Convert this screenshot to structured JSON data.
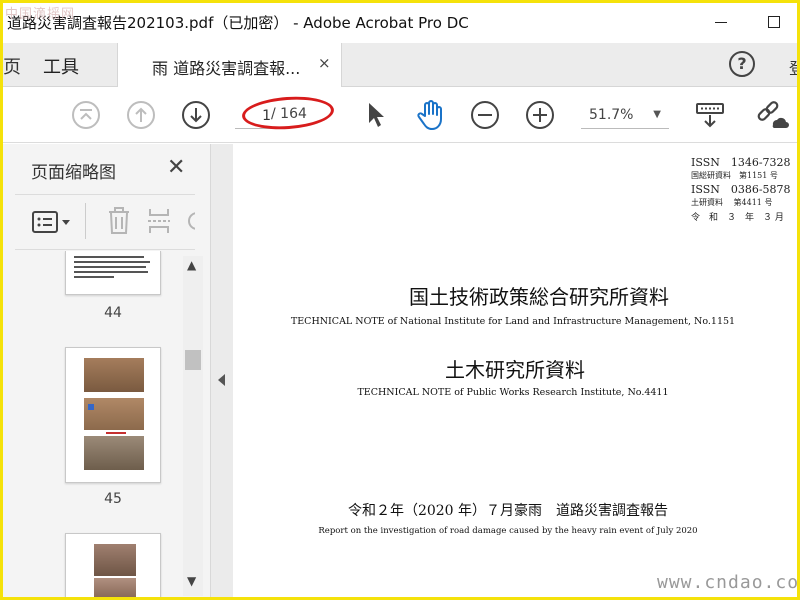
{
  "window": {
    "title": "道路災害調査報告202103.pdf（已加密） - Adobe Acrobat Pro DC",
    "watermark": "中国滴摇网"
  },
  "tabs": {
    "left_cut": "页",
    "tools": "工具",
    "document_tab": "雨 道路災害調査報...",
    "close": "×",
    "help": "?",
    "right_cut": "登"
  },
  "toolbar": {
    "current_page": "1",
    "total_pages": "/ 164",
    "zoom": "51.7%",
    "accent_color": "#1a73c8",
    "highlight_color": "#d81c1c"
  },
  "sidebar": {
    "title": "页面缩略图",
    "close": "✕",
    "thumbnails": [
      {
        "label": "44"
      },
      {
        "label": "45"
      },
      {
        "label": ""
      }
    ]
  },
  "document": {
    "issn1": "ISSN　1346-7328",
    "ref1": "国総研資料　第1151 号",
    "issn2": "ISSN　0386-5878",
    "ref2": "土研資料　 第4411 号",
    "date": "令　和　３　年　３ 月",
    "title1": "国土技術政策総合研究所資料",
    "subtitle1": "TECHNICAL NOTE of National Institute for Land and Infrastructure Management, No.1151",
    "title2": "土木研究所資料",
    "subtitle2": "TECHNICAL NOTE of Public Works Research Institute, No.4411",
    "report_title": "令和２年（2020 年）７月豪雨　道路災害調査報告",
    "report_subtitle": "Report on the investigation of road damage caused by the heavy rain event of July 2020"
  },
  "footer_watermark": "www.cndao.com"
}
